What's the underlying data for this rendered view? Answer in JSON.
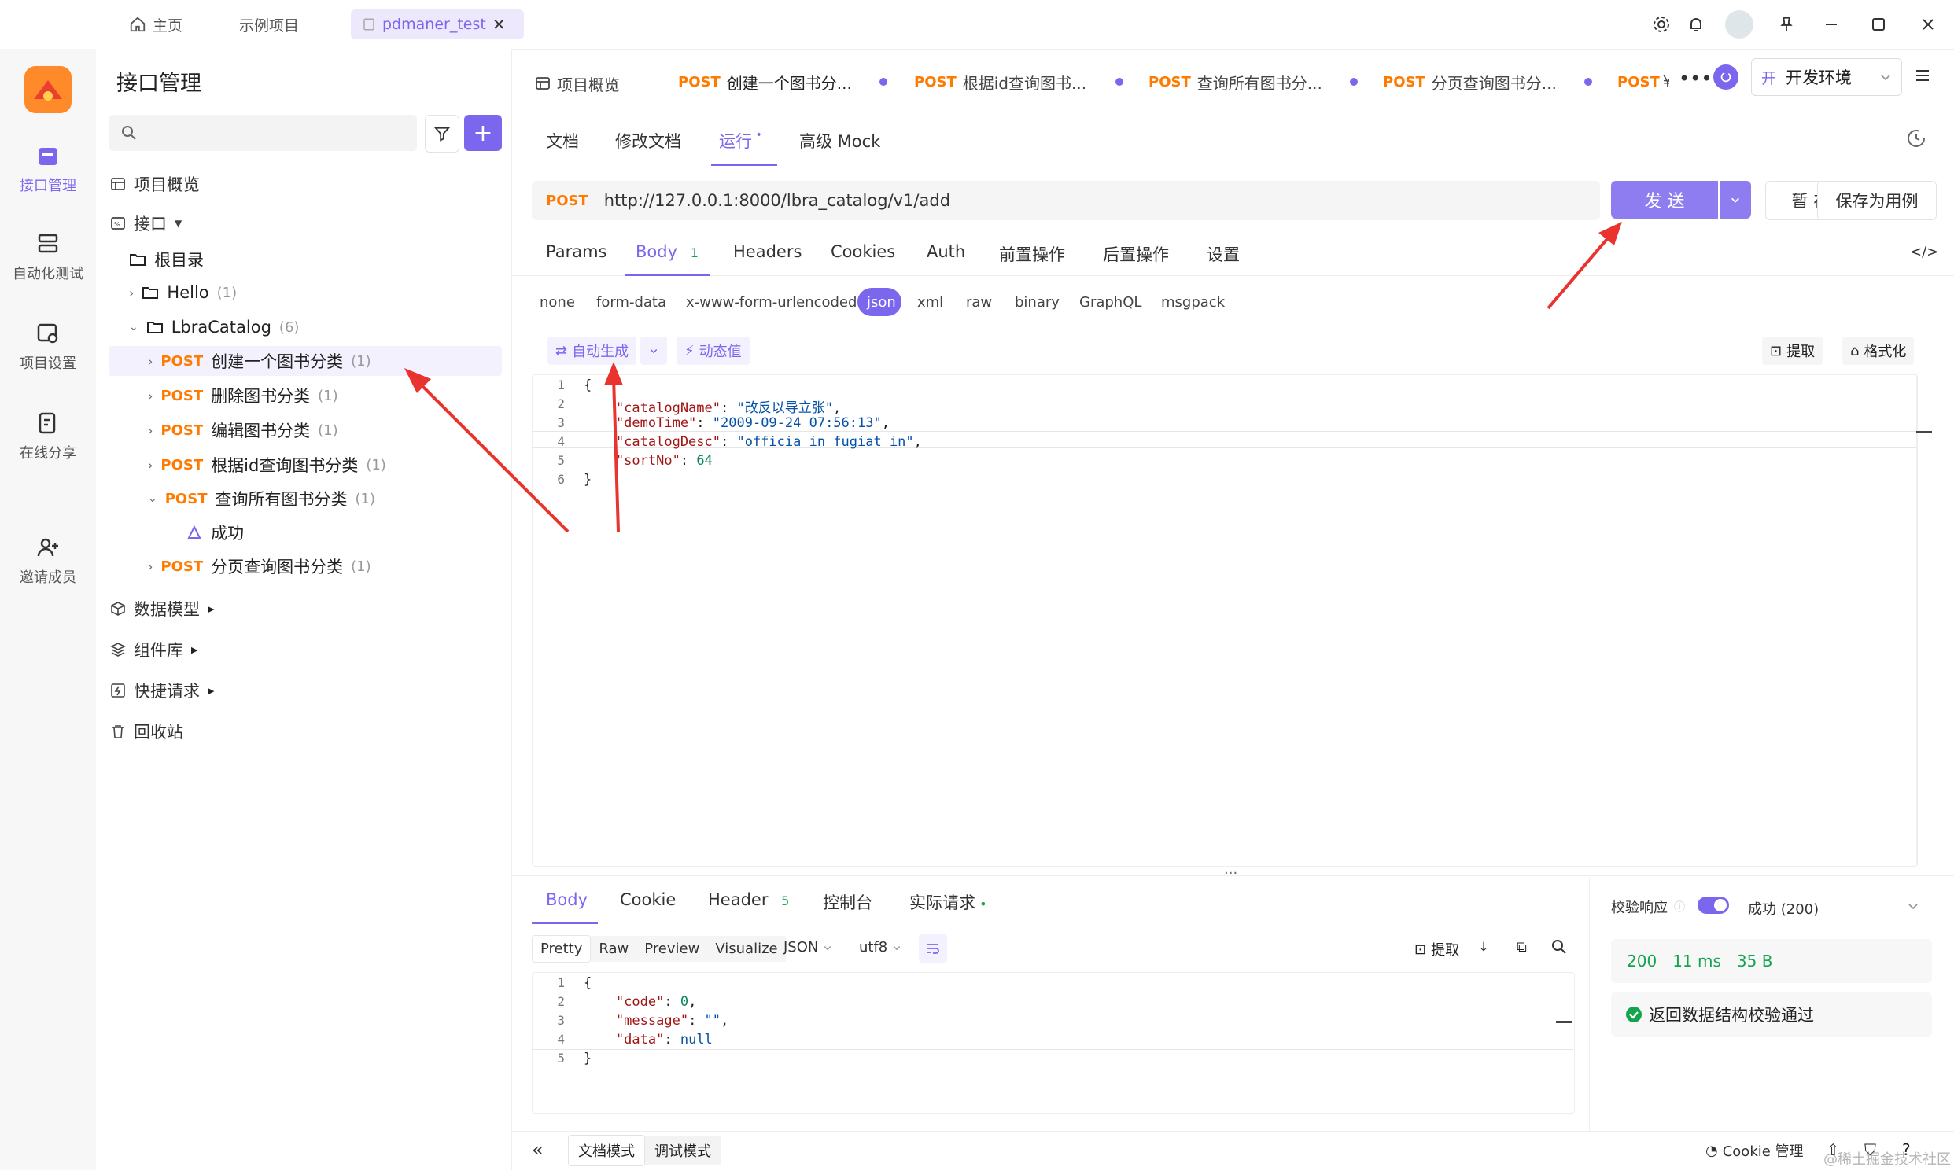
{
  "window": {
    "tabs": [
      {
        "label": "主页"
      },
      {
        "label": "示例项目"
      },
      {
        "label": "pdmaner_test"
      }
    ]
  },
  "nav": {
    "items": [
      {
        "label": "接口管理"
      },
      {
        "label": "自动化测试"
      },
      {
        "label": "项目设置"
      },
      {
        "label": "在线分享"
      },
      {
        "label": "邀请成员"
      }
    ]
  },
  "tree": {
    "title": "接口管理",
    "search_placeholder": "",
    "overview": "项目概览",
    "api_root": "接口",
    "root_dir": "根目录",
    "hello": {
      "label": "Hello",
      "count": "(1)"
    },
    "catalog": {
      "label": "LbraCatalog",
      "count": "(6)"
    },
    "apis": [
      {
        "method": "POST",
        "label": "创建一个图书分类",
        "count": "(1)"
      },
      {
        "method": "POST",
        "label": "删除图书分类",
        "count": "(1)"
      },
      {
        "method": "POST",
        "label": "编辑图书分类",
        "count": "(1)"
      },
      {
        "method": "POST",
        "label": "根据id查询图书分类",
        "count": "(1)"
      },
      {
        "method": "POST",
        "label": "查询所有图书分类",
        "count": "(1)"
      },
      {
        "method": "POST",
        "label": "分页查询图书分类",
        "count": "(1)"
      }
    ],
    "case_success": "成功",
    "sections": [
      {
        "label": "数据模型"
      },
      {
        "label": "组件库"
      },
      {
        "label": "快捷请求"
      },
      {
        "label": "回收站"
      }
    ]
  },
  "doc_tabs": {
    "overview": "项目概览",
    "tabs": [
      {
        "method": "POST",
        "label": "创建一个图书分..."
      },
      {
        "method": "POST",
        "label": "根据id查询图书..."
      },
      {
        "method": "POST",
        "label": "查询所有图书分..."
      },
      {
        "method": "POST",
        "label": "分页查询图书分..."
      },
      {
        "method": "POST",
        "label": "¥"
      }
    ],
    "env_prefix": "开",
    "env": "开发环境"
  },
  "view_tabs": [
    {
      "label": "文档"
    },
    {
      "label": "修改文档"
    },
    {
      "label": "运行"
    },
    {
      "label": "高级 Mock"
    }
  ],
  "request": {
    "method": "POST",
    "url": "http://127.0.0.1:8000/lbra_catalog/v1/add",
    "send": "发 送",
    "save_temp": "暂 存",
    "save_case": "保存为用例"
  },
  "param_tabs": [
    {
      "label": "Params"
    },
    {
      "label": "Body",
      "badge": "1"
    },
    {
      "label": "Headers"
    },
    {
      "label": "Cookies"
    },
    {
      "label": "Auth"
    },
    {
      "label": "前置操作"
    },
    {
      "label": "后置操作"
    },
    {
      "label": "设置"
    }
  ],
  "body_types": [
    "none",
    "form-data",
    "x-www-form-urlencoded",
    "json",
    "xml",
    "raw",
    "binary",
    "GraphQL",
    "msgpack"
  ],
  "body_tools": {
    "autogen": "自动生成",
    "dynamic": "动态值",
    "extract": "提取",
    "format": "格式化"
  },
  "request_code": [
    {
      "n": "1",
      "parts": [
        {
          "t": "{",
          "c": ""
        }
      ]
    },
    {
      "n": "2",
      "parts": [
        {
          "t": "    \"catalogName\"",
          "c": "key"
        },
        {
          "t": ": ",
          "c": ""
        },
        {
          "t": "\"改反以导立张\"",
          "c": "str"
        },
        {
          "t": ",",
          "c": ""
        }
      ]
    },
    {
      "n": "3",
      "parts": [
        {
          "t": "    \"demoTime\"",
          "c": "key"
        },
        {
          "t": ": ",
          "c": ""
        },
        {
          "t": "\"2009-09-24 07:56:13\"",
          "c": "str"
        },
        {
          "t": ",",
          "c": ""
        }
      ]
    },
    {
      "n": "4",
      "parts": [
        {
          "t": "    \"catalogDesc\"",
          "c": "key"
        },
        {
          "t": ": ",
          "c": ""
        },
        {
          "t": "\"officia in fugiat in\"",
          "c": "str"
        },
        {
          "t": ",",
          "c": ""
        }
      ]
    },
    {
      "n": "5",
      "parts": [
        {
          "t": "    \"sortNo\"",
          "c": "key"
        },
        {
          "t": ": ",
          "c": ""
        },
        {
          "t": "64",
          "c": "num"
        }
      ]
    },
    {
      "n": "6",
      "parts": [
        {
          "t": "}",
          "c": ""
        }
      ]
    }
  ],
  "response_tabs": [
    {
      "label": "Body"
    },
    {
      "label": "Cookie"
    },
    {
      "label": "Header",
      "badge": "5"
    },
    {
      "label": "控制台"
    },
    {
      "label": "实际请求"
    }
  ],
  "response_view": {
    "modes": [
      "Pretty",
      "Raw",
      "Preview",
      "Visualize"
    ],
    "format": "JSON",
    "encoding": "utf8",
    "extract": "提取"
  },
  "response_code": [
    {
      "n": "1",
      "parts": [
        {
          "t": "{",
          "c": ""
        }
      ]
    },
    {
      "n": "2",
      "parts": [
        {
          "t": "    \"code\"",
          "c": "key"
        },
        {
          "t": ": ",
          "c": ""
        },
        {
          "t": "0",
          "c": "num"
        },
        {
          "t": ",",
          "c": ""
        }
      ]
    },
    {
      "n": "3",
      "parts": [
        {
          "t": "    \"message\"",
          "c": "key"
        },
        {
          "t": ": ",
          "c": ""
        },
        {
          "t": "\"\"",
          "c": "str"
        },
        {
          "t": ",",
          "c": ""
        }
      ]
    },
    {
      "n": "4",
      "parts": [
        {
          "t": "    \"data\"",
          "c": "key"
        },
        {
          "t": ": ",
          "c": ""
        },
        {
          "t": "null",
          "c": "str"
        }
      ]
    },
    {
      "n": "5",
      "parts": [
        {
          "t": "}",
          "c": ""
        }
      ]
    }
  ],
  "validation": {
    "label": "校验响应",
    "status": "成功 (200)",
    "code": "200",
    "time": "11 ms",
    "size": "35 B",
    "result": "返回数据结构校验通过"
  },
  "footer": {
    "doc_mode": "文档模式",
    "debug_mode": "调试模式",
    "cookie": "Cookie 管理",
    "watermark": "@稀土掘金技术社区"
  },
  "colors": {
    "accent": "#7b67ee",
    "post": "#ff7a00",
    "success": "#14a44d",
    "arrow": "#e8332f"
  }
}
